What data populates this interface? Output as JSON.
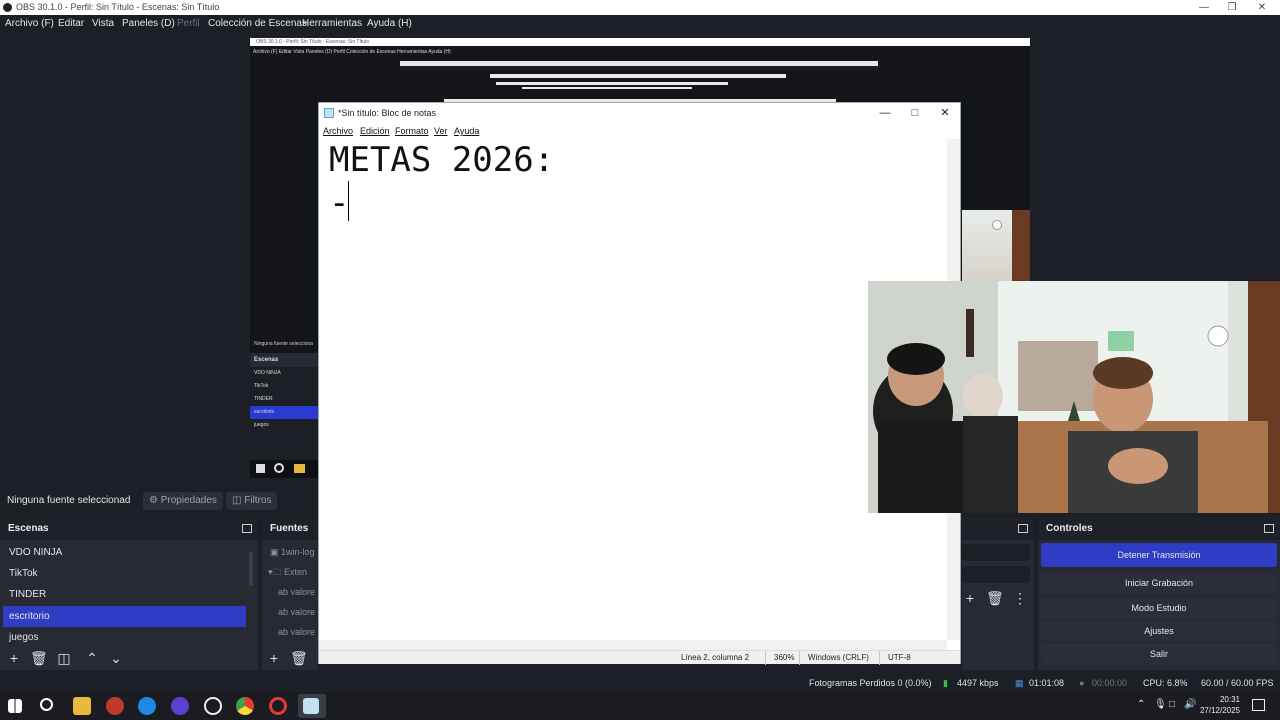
{
  "obs": {
    "title": "OBS 30.1.0 - Perfil: Sin Título - Escenas: Sin Título",
    "menu": [
      "Archivo (F)",
      "Editar",
      "Vista",
      "Paneles (D)",
      "Perfil",
      "Colección de Escenas",
      "Herramientas",
      "Ayuda (H)"
    ],
    "no_source": "Ninguna fuente seleccionad",
    "properties_label": "Propiedades",
    "filters_label": "Filtros",
    "scenes_title": "Escenas",
    "scenes": [
      "VDO NINJA",
      "TikTok",
      "TINDER",
      "escritorio",
      "juegos"
    ],
    "selected_scene": "escritorio",
    "sources_title": "Fuentes",
    "sources": [
      "1win-log",
      "Exten",
      "valore",
      "valore",
      "valore"
    ],
    "controls_title": "Controles",
    "controls": [
      "Detener Transmisión",
      "Iniciar Grabación",
      "Modo Estudio",
      "Ajustes",
      "Salir"
    ],
    "status": {
      "dropped": "Fotogramas Perdidos 0 (0.0%)",
      "bitrate": "4497 kbps",
      "stream_time": "01:01:08",
      "rec_time": "00:00:00",
      "cpu": "CPU: 6.8%",
      "fps": "60.00 / 60.00 FPS"
    }
  },
  "preview": {
    "title": "OBS 30.1.0 - Perfil: Sin Título - Escenas: Sin Título",
    "menu": "Archivo (F)   Editar   Vista   Paneles (D)   Perfil   Colección de Escenas   Herramientas   Ayuda (H)",
    "no_source": "Ninguna fuente selecciona",
    "scenes_title": "Escenas",
    "scenes": [
      "VDO NINJA",
      "TikTok",
      "TINDER",
      "escritorio",
      "juegos"
    ]
  },
  "notepad": {
    "title": "*Sin título: Bloc de notas",
    "menu": [
      "Archivo",
      "Edición",
      "Formato",
      "Ver",
      "Ayuda"
    ],
    "content": "METAS 2026:\n-",
    "status": {
      "position": "Línea 2, columna 2",
      "zoom": "360%",
      "eol": "Windows (CRLF)",
      "encoding": "UTF-8"
    }
  },
  "taskbar": {
    "time": "20:31",
    "date": "27/12/2025"
  }
}
